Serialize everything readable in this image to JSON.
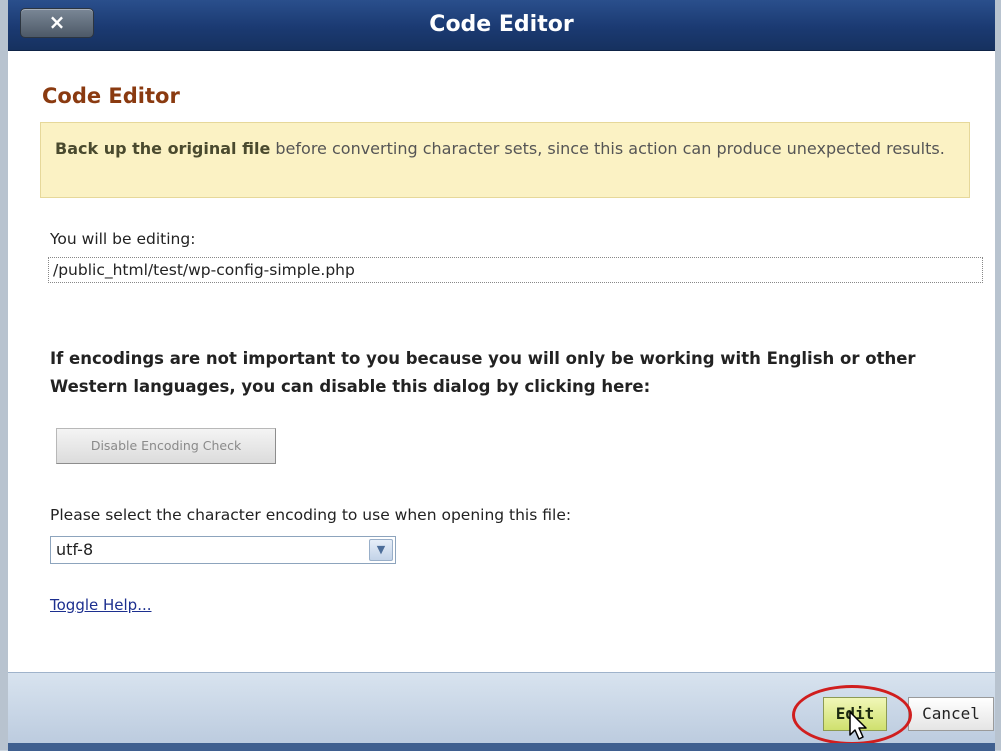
{
  "window": {
    "title": "Code Editor",
    "close_label": "×"
  },
  "main": {
    "heading": "Code Editor",
    "warning_bold": "Back up the original file",
    "warning_text": " before converting character sets, since this action can produce unexpected results.",
    "editing_label": "You will be editing:",
    "file_path": "/public_html/test/wp-config-simple.php",
    "encoding_note": "If encodings are not important to you because you will only be working with English or other Western languages, you can disable this dialog by clicking here:",
    "disable_button_label": "Disable Encoding Check",
    "select_label": "Please select the character encoding to use when opening this file:",
    "encoding_selected": "utf-8",
    "toggle_help_label": "Toggle Help..."
  },
  "footer": {
    "edit_label": "Edit",
    "cancel_label": "Cancel"
  },
  "colors": {
    "titlebar": "#1b3a72",
    "heading": "#8a3a10",
    "warning_bg": "#fbf2c4",
    "edit_button": "#cfe06e",
    "highlight": "#d01e1e"
  },
  "icons": {
    "close": "close-icon",
    "dropdown": "chevron-down-icon",
    "cursor": "cursor-icon"
  }
}
